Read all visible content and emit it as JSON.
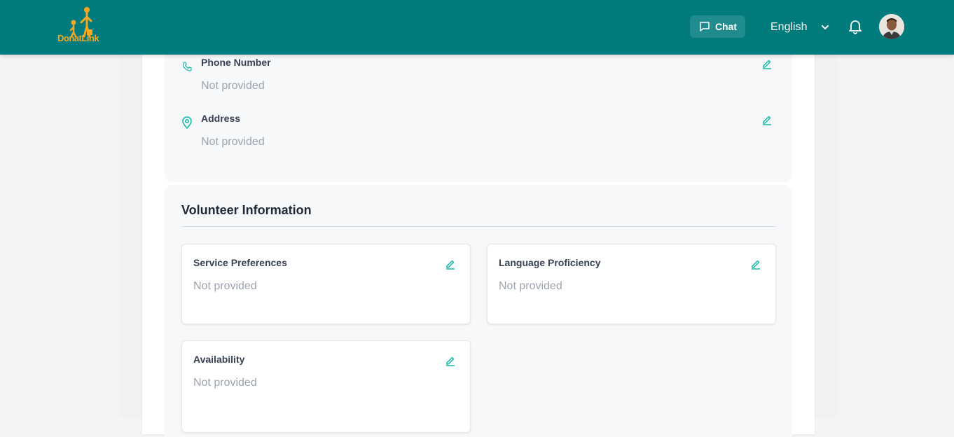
{
  "header": {
    "logo_text": "DonatLink",
    "chat_label": "Chat",
    "language": "English",
    "colors": {
      "bar": "#017b7c",
      "logo": "#f5a623",
      "accent": "#14b8a6"
    }
  },
  "contact": {
    "phone": {
      "label": "Phone Number",
      "value": "Not provided",
      "icon": "phone-icon"
    },
    "address": {
      "label": "Address",
      "value": "Not provided",
      "icon": "map-pin-icon"
    }
  },
  "volunteer": {
    "title": "Volunteer Information",
    "cards": [
      {
        "label": "Service Preferences",
        "value": "Not provided"
      },
      {
        "label": "Language Proficiency",
        "value": "Not provided"
      },
      {
        "label": "Availability",
        "value": "Not provided"
      }
    ]
  }
}
